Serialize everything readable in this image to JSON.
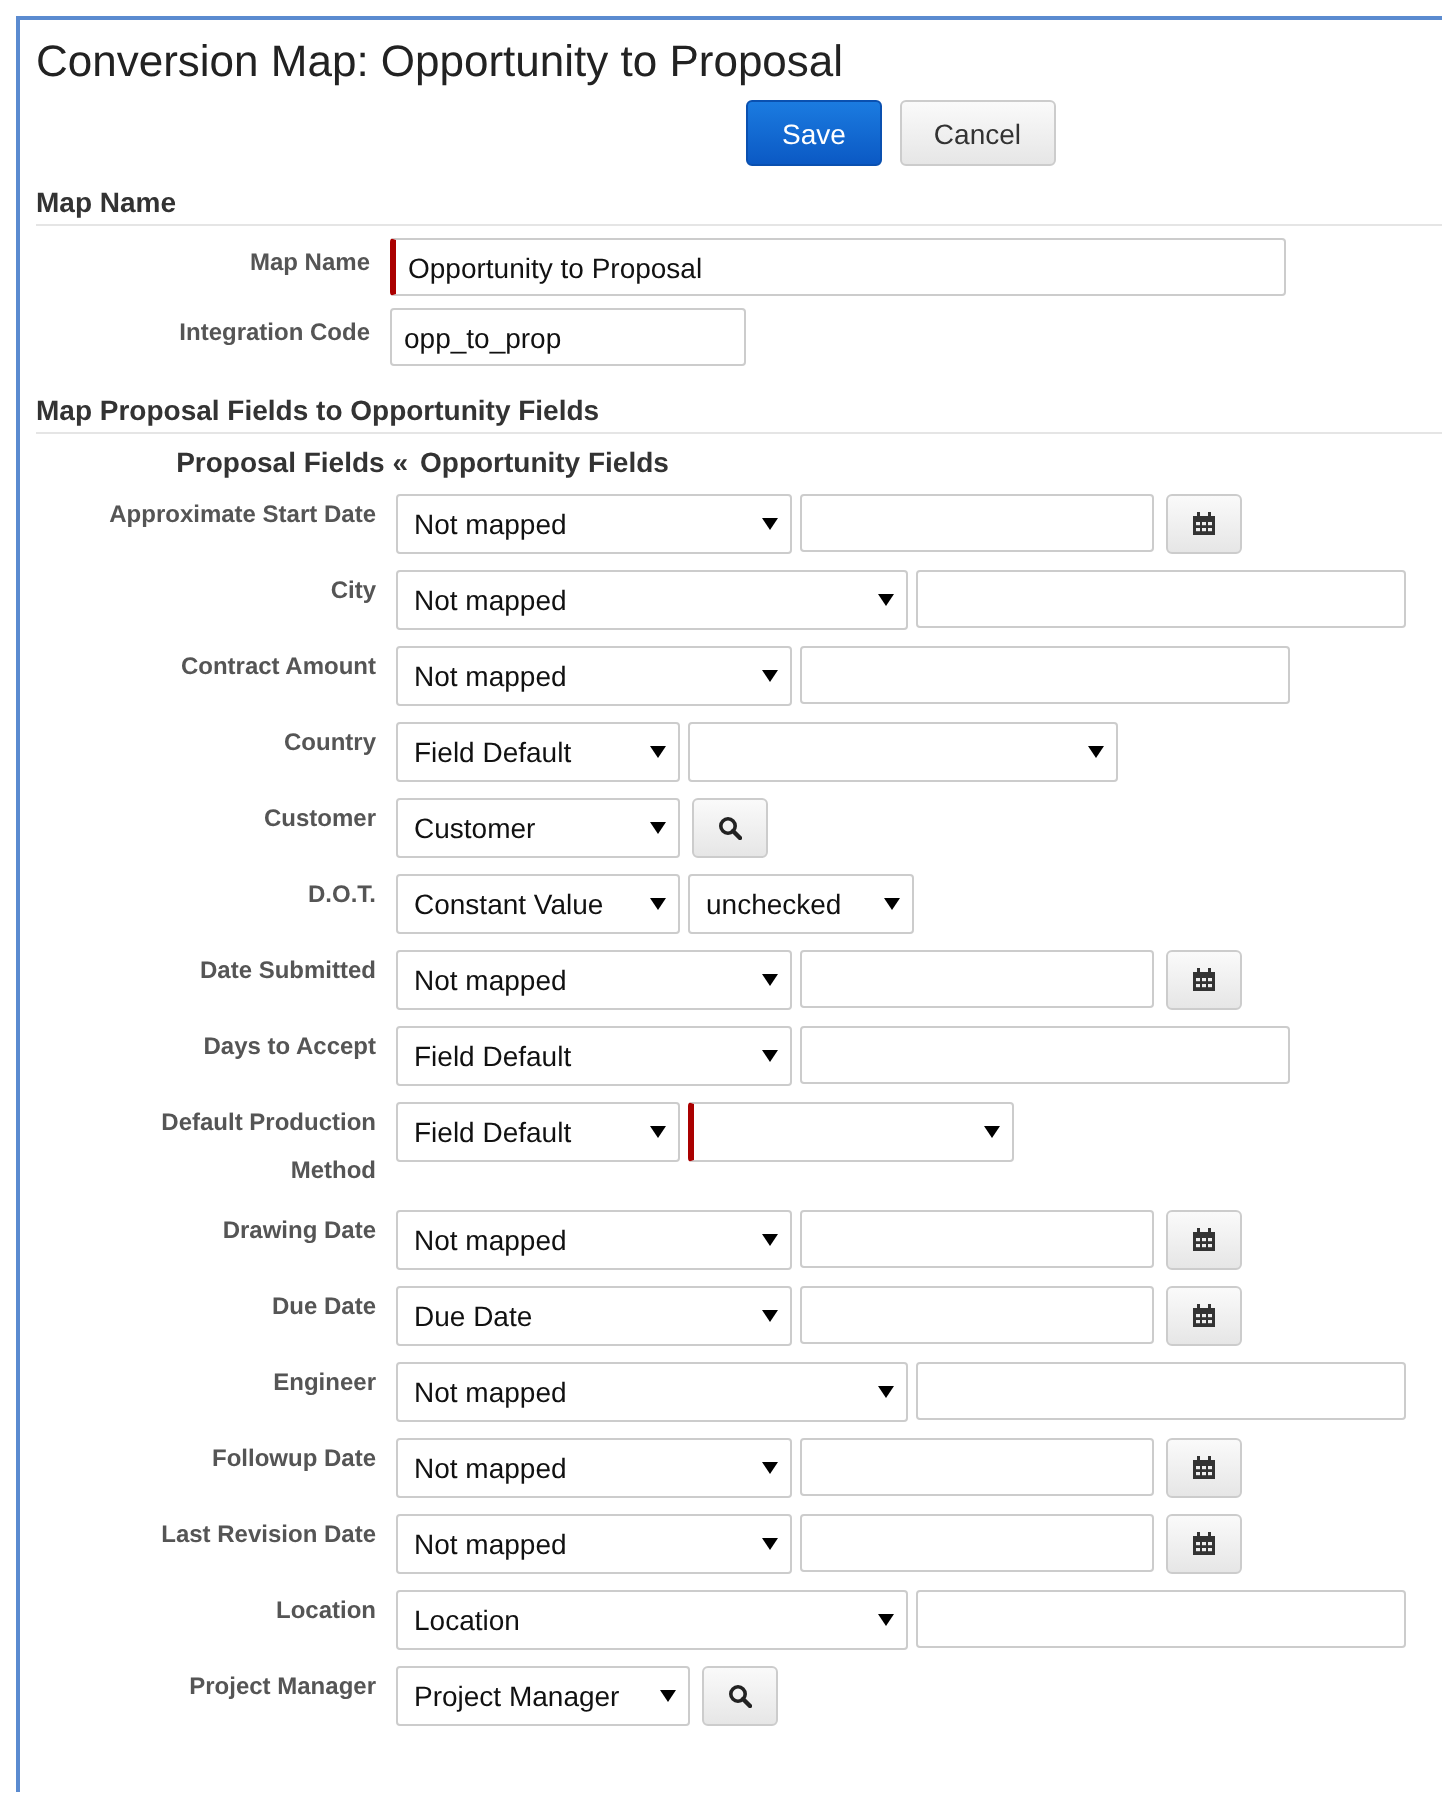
{
  "title": "Conversion Map: Opportunity to Proposal",
  "buttons": [
    {
      "label": "Save",
      "kind": "primary"
    },
    {
      "label": "Cancel",
      "kind": "default"
    }
  ],
  "map_name_section": {
    "heading": "Map Name",
    "fields": [
      {
        "label": "Map Name",
        "value": "Opportunity to Proposal",
        "required": true
      },
      {
        "label": "Integration Code",
        "value": "opp_to_prop",
        "required": false
      }
    ]
  },
  "mapping_section": {
    "heading": "Map Proposal Fields to Opportunity Fields",
    "column_left": "Proposal Fields «",
    "column_right": "Opportunity Fields",
    "rows": [
      {
        "label": "Approximate Start Date",
        "mapping": "Not mapped",
        "kind": "date"
      },
      {
        "label": "City",
        "mapping": "Not mapped",
        "kind": "text"
      },
      {
        "label": "Contract Amount",
        "mapping": "Not mapped",
        "kind": "text"
      },
      {
        "label": "Country",
        "mapping": "Field Default",
        "kind": "select",
        "required": false
      },
      {
        "label": "Customer",
        "mapping": "Customer",
        "kind": "lookup"
      },
      {
        "label": "D.O.T.",
        "mapping": "Constant Value",
        "kind": "select",
        "value": "unchecked",
        "required": false
      },
      {
        "label": "Date Submitted",
        "mapping": "Not mapped",
        "kind": "date"
      },
      {
        "label": "Days to Accept",
        "mapping": "Field Default",
        "kind": "text"
      },
      {
        "label": "Default Production Method",
        "mapping": "Field Default",
        "kind": "select",
        "required": true
      },
      {
        "label": "Drawing Date",
        "mapping": "Not mapped",
        "kind": "date"
      },
      {
        "label": "Due Date",
        "mapping": "Due Date",
        "kind": "date"
      },
      {
        "label": "Engineer",
        "mapping": "Not mapped",
        "kind": "text"
      },
      {
        "label": "Followup Date",
        "mapping": "Not mapped",
        "kind": "date"
      },
      {
        "label": "Last Revision Date",
        "mapping": "Not mapped",
        "kind": "date"
      },
      {
        "label": "Location",
        "mapping": "Location",
        "kind": "text"
      },
      {
        "label": "Project Manager",
        "mapping": "Project Manager",
        "kind": "lookup"
      }
    ]
  }
}
